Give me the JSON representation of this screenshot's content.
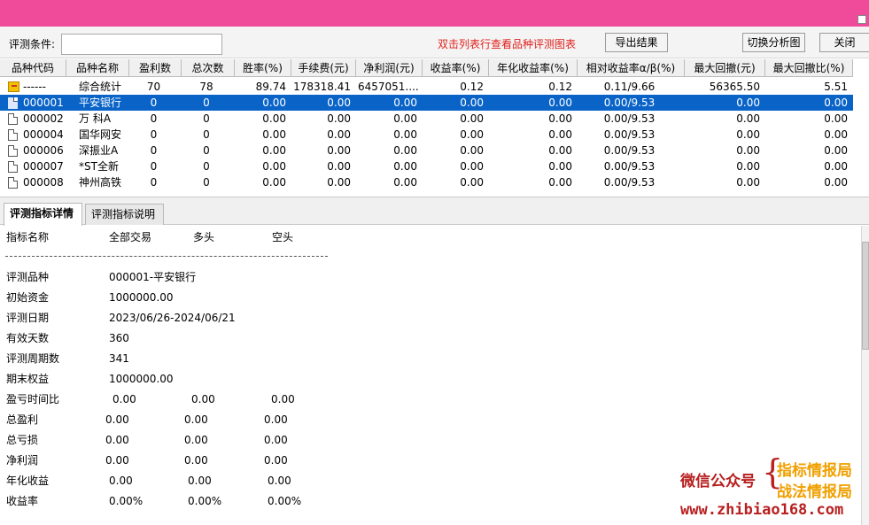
{
  "toolbar": {
    "cond_label": "评测条件:",
    "cond_value": "",
    "hint": "双击列表行查看品种评测图表",
    "export_label": "导出结果",
    "switch_label": "切换分析图",
    "close_label": "关闭"
  },
  "grid": {
    "headers": [
      "品种代码",
      "品种名称",
      "盈利数",
      "总次数",
      "胜率(%)",
      "手续费(元)",
      "净利润(元)",
      "收益率(%)",
      "年化收益率(%)",
      "相对收益率α/β(%)",
      "最大回撤(元)",
      "最大回撤比(%)"
    ],
    "rows": [
      {
        "code": "------",
        "name": "综合统计",
        "wins": "70",
        "total": "78",
        "win_rate": "89.74",
        "fee": "178318.41",
        "net_profit": "6457051....",
        "return": "0.12",
        "annual_return": "0.12",
        "relative": "0.11/9.66",
        "max_dd": "56365.50",
        "max_dd_ratio": "5.51"
      },
      {
        "code": "000001",
        "name": "平安银行",
        "wins": "0",
        "total": "0",
        "win_rate": "0.00",
        "fee": "0.00",
        "net_profit": "0.00",
        "return": "0.00",
        "annual_return": "0.00",
        "relative": "0.00/9.53",
        "max_dd": "0.00",
        "max_dd_ratio": "0.00"
      },
      {
        "code": "000002",
        "name": "万 科A",
        "wins": "0",
        "total": "0",
        "win_rate": "0.00",
        "fee": "0.00",
        "net_profit": "0.00",
        "return": "0.00",
        "annual_return": "0.00",
        "relative": "0.00/9.53",
        "max_dd": "0.00",
        "max_dd_ratio": "0.00"
      },
      {
        "code": "000004",
        "name": "国华网安",
        "wins": "0",
        "total": "0",
        "win_rate": "0.00",
        "fee": "0.00",
        "net_profit": "0.00",
        "return": "0.00",
        "annual_return": "0.00",
        "relative": "0.00/9.53",
        "max_dd": "0.00",
        "max_dd_ratio": "0.00"
      },
      {
        "code": "000006",
        "name": "深振业A",
        "wins": "0",
        "total": "0",
        "win_rate": "0.00",
        "fee": "0.00",
        "net_profit": "0.00",
        "return": "0.00",
        "annual_return": "0.00",
        "relative": "0.00/9.53",
        "max_dd": "0.00",
        "max_dd_ratio": "0.00"
      },
      {
        "code": "000007",
        "name": "*ST全新",
        "wins": "0",
        "total": "0",
        "win_rate": "0.00",
        "fee": "0.00",
        "net_profit": "0.00",
        "return": "0.00",
        "annual_return": "0.00",
        "relative": "0.00/9.53",
        "max_dd": "0.00",
        "max_dd_ratio": "0.00"
      },
      {
        "code": "000008",
        "name": "神州高铁",
        "wins": "0",
        "total": "0",
        "win_rate": "0.00",
        "fee": "0.00",
        "net_profit": "0.00",
        "return": "0.00",
        "annual_return": "0.00",
        "relative": "0.00/9.53",
        "max_dd": "0.00",
        "max_dd_ratio": "0.00"
      }
    ]
  },
  "tabs": {
    "detail": "评测指标详情",
    "desc": "评测指标说明"
  },
  "detail": {
    "header": {
      "name": "指标名称",
      "all": "全部交易",
      "long": "多头",
      "short": "空头"
    },
    "rows": [
      {
        "label": "评测品种",
        "all": "000001-平安银行",
        "long": "",
        "short": ""
      },
      {
        "label": "初始资金",
        "all": "1000000.00",
        "long": "",
        "short": ""
      },
      {
        "label": "评测日期",
        "all": "2023/06/26-2024/06/21",
        "long": "",
        "short": ""
      },
      {
        "label": "有效天数",
        "all": "360",
        "long": "",
        "short": ""
      },
      {
        "label": "评测周期数",
        "all": "341",
        "long": "",
        "short": ""
      },
      {
        "label": "期末权益",
        "all": "1000000.00",
        "long": "",
        "short": ""
      },
      {
        "label": "盈亏时间比",
        "all": "0.00",
        "long": "0.00",
        "short": "0.00"
      },
      {
        "label": "总盈利",
        "all": "0.00",
        "long": "0.00",
        "short": "0.00"
      },
      {
        "label": "总亏损",
        "all": "0.00",
        "long": "0.00",
        "short": "0.00"
      },
      {
        "label": "净利润",
        "all": "0.00",
        "long": "0.00",
        "short": "0.00"
      },
      {
        "label": "年化收益",
        "all": "0.00",
        "long": "0.00",
        "short": "0.00"
      },
      {
        "label": "收益率",
        "all": "0.00%",
        "long": "0.00%",
        "short": "0.00%"
      }
    ]
  },
  "watermark": {
    "label": "微信公众号",
    "brace": "{",
    "top": "指标情报局",
    "bottom": "战法情报局",
    "url": "www.zhibiao168.com"
  },
  "colors": {
    "titlebar": "#f04a9a",
    "selection": "#0a64c8",
    "hint": "#e0211c",
    "watermark_red": "#b81f1f",
    "watermark_gold": "#f0a000"
  }
}
